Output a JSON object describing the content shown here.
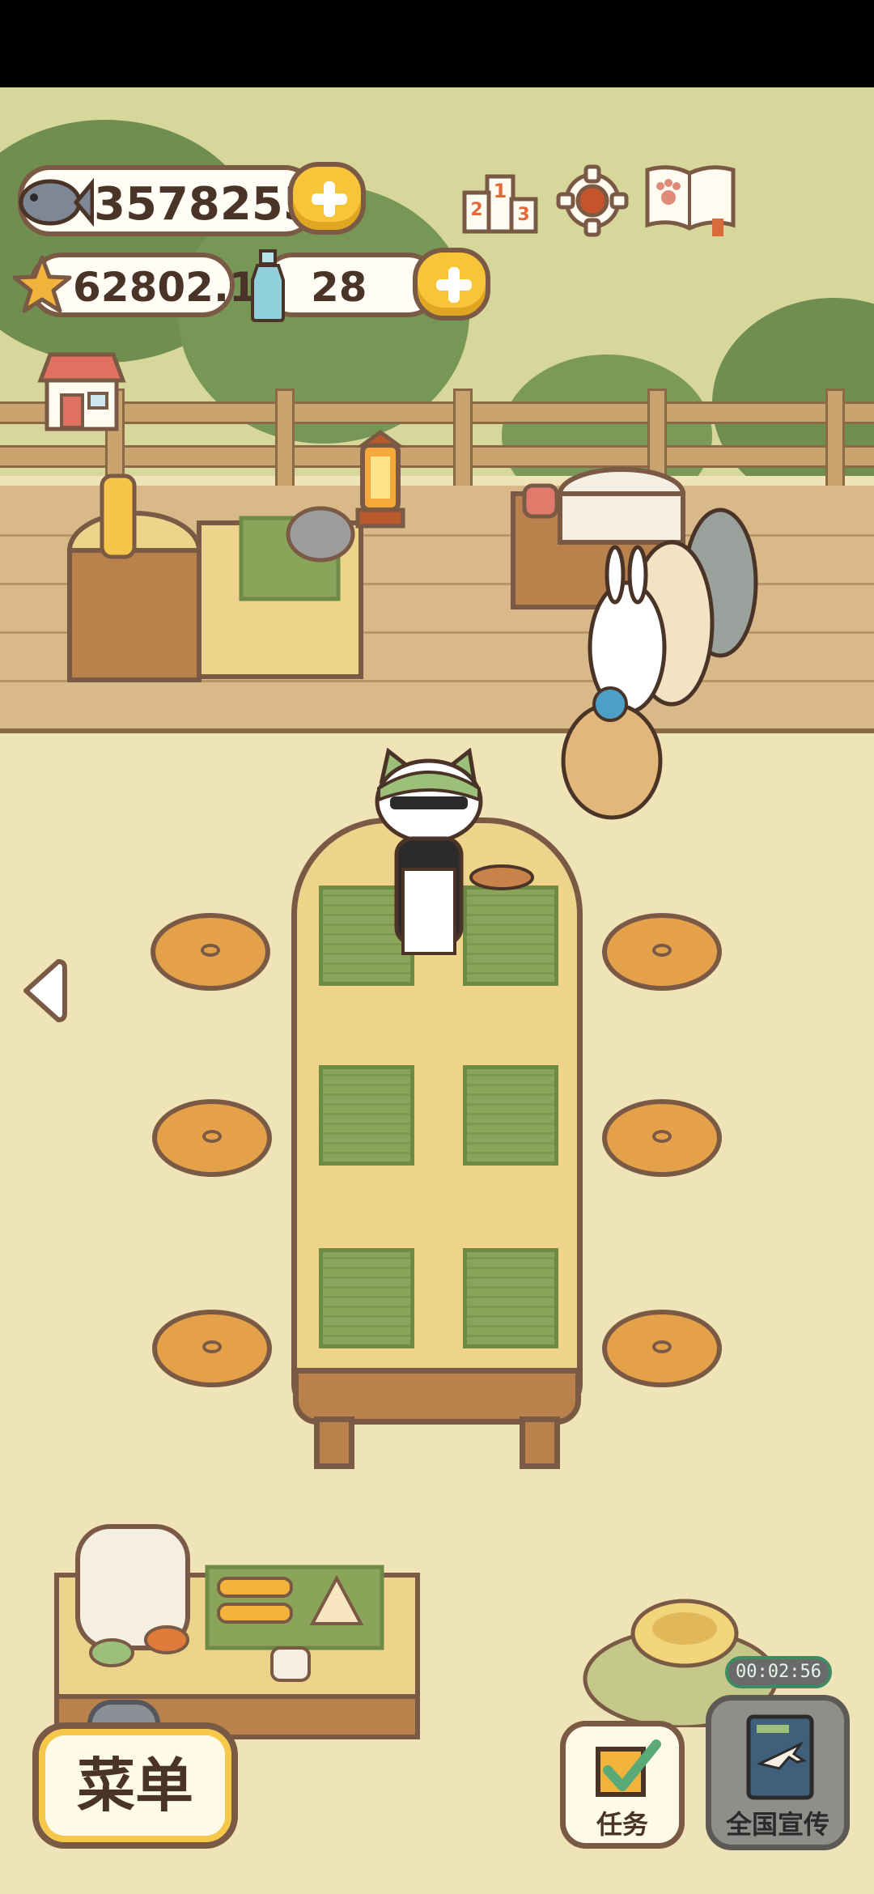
{
  "currencies": {
    "fish": {
      "icon": "fish-icon",
      "value": "3578255"
    },
    "star": {
      "icon": "star-icon",
      "value": "62802.1"
    },
    "bottle": {
      "icon": "bottle-icon",
      "value": "28"
    }
  },
  "top_icons": [
    "ranking-podium-icon",
    "settings-gear-icon",
    "paw-book-icon"
  ],
  "shop": {
    "icon": "shop-icon"
  },
  "bottom_bar": {
    "menu_label": "菜单",
    "tasks_label": "任务",
    "promo_label": "全国宣传",
    "promo_timer": "00:02:56"
  },
  "colors": {
    "outline": "#7a5a44",
    "accent_yellow": "#f8c43a",
    "grass": "#d7d79c",
    "floor": "#efe3b8"
  }
}
